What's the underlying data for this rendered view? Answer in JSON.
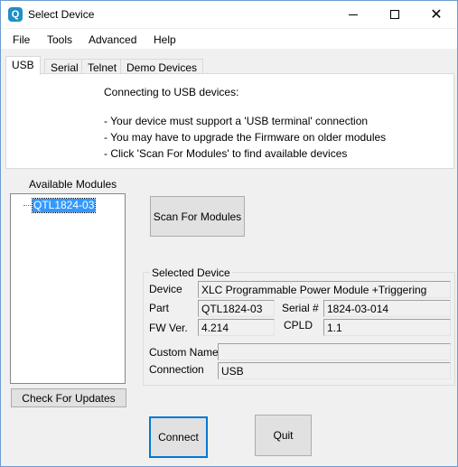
{
  "window": {
    "title": "Select Device"
  },
  "menu": {
    "items": [
      "File",
      "Tools",
      "Advanced",
      "Help"
    ]
  },
  "tabs": [
    "USB",
    "Serial",
    "Telnet",
    "Demo Devices"
  ],
  "usb_info": {
    "heading": "Connecting to USB devices:",
    "lines": [
      "- Your device must support a 'USB terminal' connection",
      "- You may have to upgrade the Firmware on older modules",
      "- Click 'Scan For Modules' to find available devices"
    ]
  },
  "modules": {
    "label": "Available Modules",
    "items": [
      "QTL1824-03"
    ]
  },
  "buttons": {
    "scan": "Scan For Modules",
    "check_updates": "Check For Updates",
    "connect": "Connect",
    "quit": "Quit"
  },
  "selected_device": {
    "title": "Selected Device",
    "device_label": "Device",
    "device_value": "XLC Programmable Power Module +Triggering",
    "part_label": "Part",
    "part_value": "QTL1824-03",
    "serial_label": "Serial #",
    "serial_value": "1824-03-014",
    "fw_label": "FW Ver.",
    "fw_value": "4.214",
    "cpld_label": "CPLD",
    "cpld_value": "1.1",
    "custom_name_label": "Custom Name",
    "custom_name_value": "",
    "connection_label": "Connection",
    "connection_value": "USB"
  },
  "colors": {
    "accent": "#0078d7",
    "selection": "#3399ff",
    "app_icon": "#1f8fc7"
  }
}
